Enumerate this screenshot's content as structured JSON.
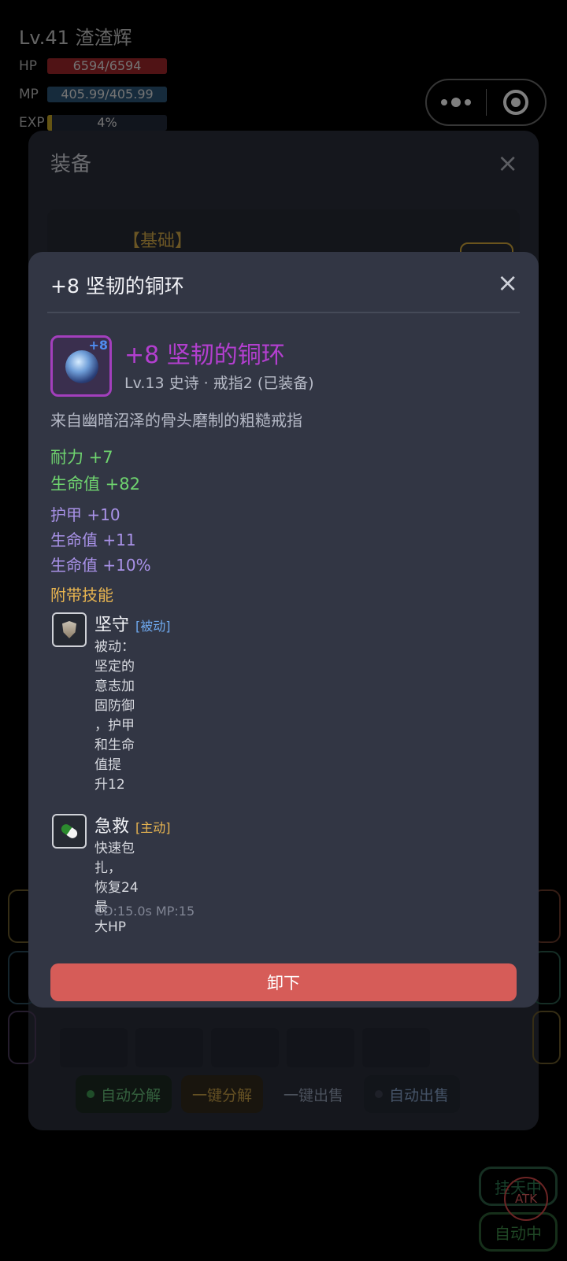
{
  "hud": {
    "name": "Lv.41 渣渣辉",
    "hp_label": "HP",
    "hp_text": "6594/6594",
    "mp_label": "MP",
    "mp_text": "405.99/405.99",
    "exp_label": "EXP",
    "exp_text": "4%",
    "exp_fraction": 0.04
  },
  "equip_panel": {
    "title": "装备",
    "close_icon": "×",
    "section_tag": "【基础】",
    "actions": {
      "auto_decompose": "自动分解",
      "one_click_decompose": "一键分解",
      "one_click_sell": "一键出售",
      "auto_sell": "自动出售"
    }
  },
  "float_buttons": {
    "hangup": "挂天中",
    "auto": "自动中",
    "atk": "ATK"
  },
  "dialog": {
    "title": "+8 坚韧的铜环",
    "close_icon": "×",
    "item": {
      "icon": "ring-icon",
      "enhance": "+8",
      "name": "+8 坚韧的铜环",
      "meta": "Lv.13 史诗 · 戒指2 (已装备)",
      "desc": "来自幽暗沼泽的骨头磨制的粗糙戒指"
    },
    "base_stats": [
      "耐力 +7",
      "生命值 +82"
    ],
    "extra_stats": [
      "护甲 +10",
      "生命值 +11",
      "生命值 +10%"
    ],
    "skills_heading": "附带技能",
    "skills": [
      {
        "icon": "shield-icon",
        "name": "坚守",
        "type": "[被动]",
        "desc_lines": [
          "被动：",
          "坚定的",
          "意志加",
          "固防御",
          "，护甲",
          "和生命",
          "值提",
          "升12"
        ]
      },
      {
        "icon": "pill-icon",
        "name": "急救",
        "type": "[主动]",
        "desc_lines": [
          "快速包扎，",
          "恢复24最",
          "大HP"
        ],
        "cd": "CD:15.0s  MP:15"
      }
    ],
    "unequip_label": "卸下"
  },
  "colors": {
    "epic": "#b33fcf",
    "green_stat": "#6fd46f",
    "purple_stat": "#a992e8",
    "skill_heading": "#e7b450",
    "passive_tag": "#6ea8ee",
    "active_tag": "#e7b450",
    "unequip_button": "#d65c58"
  }
}
